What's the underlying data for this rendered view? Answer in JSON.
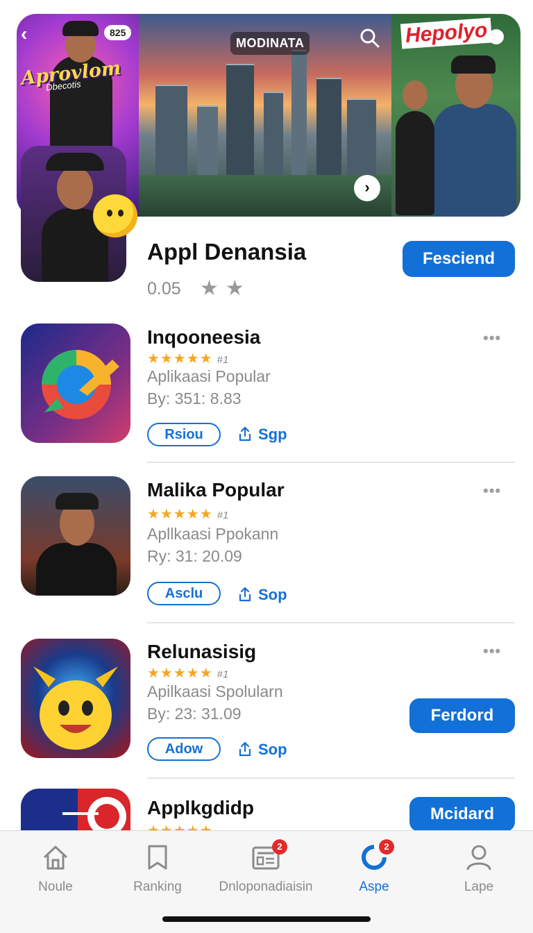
{
  "hero": {
    "badge": "825",
    "left_title": "Aprovlom",
    "left_subtitle": "Dbecotis",
    "city_logo": "MODINATA",
    "right_title": "Hepolyo"
  },
  "featured": {
    "title": "Appl Denansia",
    "rating": "0.05",
    "stars": "★★",
    "button": "Fesciend"
  },
  "apps": [
    {
      "name": "Inqooneesia",
      "stars": "★★★★★",
      "rank": "#1",
      "subtitle": "Aplikaasi Popular",
      "by": "By: 351: 8.83",
      "pill": "Rsiou",
      "share": "Sgp",
      "more": "•••"
    },
    {
      "name": "Malika Popular",
      "stars": "★★★★★",
      "rank": "#1",
      "subtitle": "Apllkaasi Ppokann",
      "by": "Ry: 31: 20.09",
      "pill": "Asclu",
      "share": "Sop",
      "more": "•••"
    },
    {
      "name": "Relunasisig",
      "stars": "★★★★★",
      "rank": "#1",
      "subtitle": "Apilkaasi Spolularn",
      "by": "By: 23: 31.09",
      "pill": "Adow",
      "share": "Sop",
      "more": "•••",
      "button": "Ferdord"
    },
    {
      "name": "Applkgdidp",
      "stars": "★★★★★",
      "button": "Mcidard"
    }
  ],
  "tabbar": {
    "tabs": [
      {
        "label": "Noule",
        "icon": "home-icon"
      },
      {
        "label": "Ranking",
        "icon": "bookmark-icon"
      },
      {
        "label": "Dnloponadiaisin",
        "icon": "news-icon",
        "badge": "2"
      },
      {
        "label": "Aspe",
        "icon": "apps-icon",
        "badge": "2",
        "active": true
      },
      {
        "label": "Lape",
        "icon": "person-icon"
      }
    ]
  },
  "colors": {
    "accent": "#1370d6",
    "star": "#f5a623",
    "badge": "#e32a2a"
  }
}
